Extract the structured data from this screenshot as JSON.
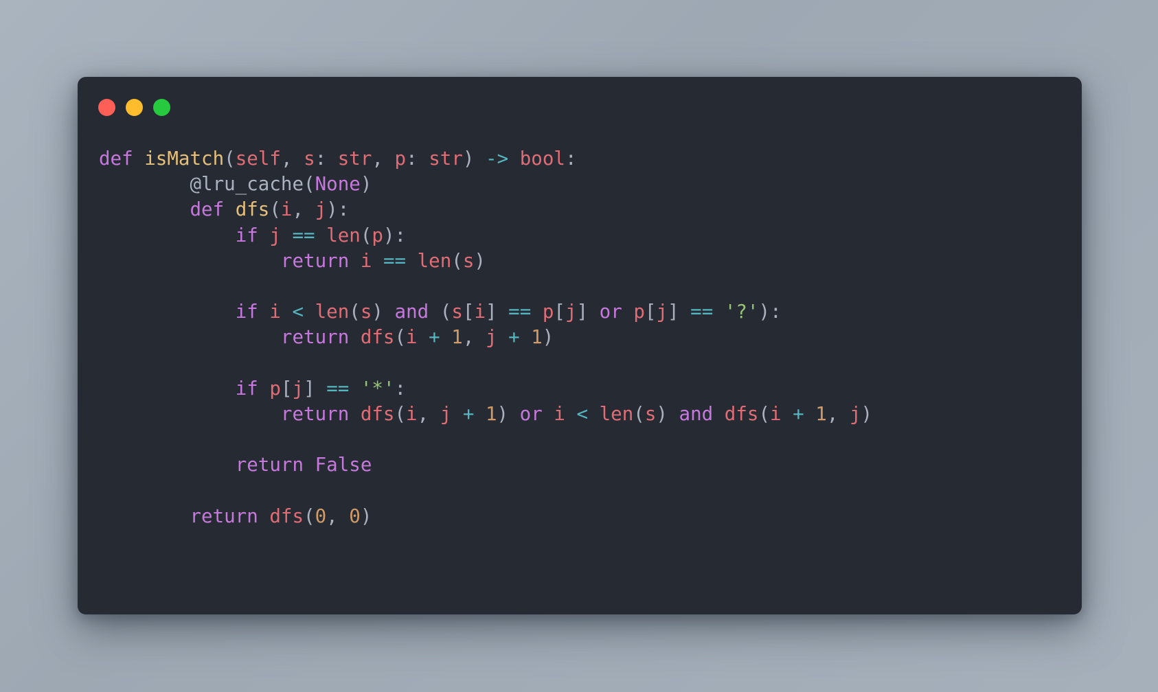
{
  "window": {
    "controls": [
      {
        "name": "close",
        "color": "#ff5f56"
      },
      {
        "name": "minimize",
        "color": "#ffbd2e"
      },
      {
        "name": "maximize",
        "color": "#27c93f"
      }
    ]
  },
  "code": {
    "language": "python",
    "lines": [
      [
        [
          "kw",
          "def"
        ],
        [
          "pu",
          " "
        ],
        [
          "fn",
          "isMatch"
        ],
        [
          "pu",
          "("
        ],
        [
          "var",
          "self"
        ],
        [
          "pu",
          ", "
        ],
        [
          "var",
          "s"
        ],
        [
          "pu",
          ": "
        ],
        [
          "ty",
          "str"
        ],
        [
          "pu",
          ", "
        ],
        [
          "var",
          "p"
        ],
        [
          "pu",
          ": "
        ],
        [
          "ty",
          "str"
        ],
        [
          "pu",
          ") "
        ],
        [
          "op",
          "->"
        ],
        [
          "pu",
          " "
        ],
        [
          "ty",
          "bool"
        ],
        [
          "pu",
          ":"
        ]
      ],
      [
        [
          "pu",
          "        "
        ],
        [
          "dec",
          "@lru_cache("
        ],
        [
          "const",
          "None"
        ],
        [
          "dec",
          ")"
        ]
      ],
      [
        [
          "pu",
          "        "
        ],
        [
          "kw",
          "def"
        ],
        [
          "pu",
          " "
        ],
        [
          "fn",
          "dfs"
        ],
        [
          "pu",
          "("
        ],
        [
          "var",
          "i"
        ],
        [
          "pu",
          ", "
        ],
        [
          "var",
          "j"
        ],
        [
          "pu",
          "):"
        ]
      ],
      [
        [
          "pu",
          "            "
        ],
        [
          "kw",
          "if"
        ],
        [
          "pu",
          " "
        ],
        [
          "var",
          "j"
        ],
        [
          "pu",
          " "
        ],
        [
          "op",
          "=="
        ],
        [
          "pu",
          " "
        ],
        [
          "fc",
          "len"
        ],
        [
          "pu",
          "("
        ],
        [
          "var",
          "p"
        ],
        [
          "pu",
          "):"
        ]
      ],
      [
        [
          "pu",
          "                "
        ],
        [
          "kw",
          "return"
        ],
        [
          "pu",
          " "
        ],
        [
          "var",
          "i"
        ],
        [
          "pu",
          " "
        ],
        [
          "op",
          "=="
        ],
        [
          "pu",
          " "
        ],
        [
          "fc",
          "len"
        ],
        [
          "pu",
          "("
        ],
        [
          "var",
          "s"
        ],
        [
          "pu",
          ")"
        ]
      ],
      [],
      [
        [
          "pu",
          "            "
        ],
        [
          "kw",
          "if"
        ],
        [
          "pu",
          " "
        ],
        [
          "var",
          "i"
        ],
        [
          "pu",
          " "
        ],
        [
          "op",
          "<"
        ],
        [
          "pu",
          " "
        ],
        [
          "fc",
          "len"
        ],
        [
          "pu",
          "("
        ],
        [
          "var",
          "s"
        ],
        [
          "pu",
          ") "
        ],
        [
          "kw",
          "and"
        ],
        [
          "pu",
          " ("
        ],
        [
          "var",
          "s"
        ],
        [
          "pu",
          "["
        ],
        [
          "var",
          "i"
        ],
        [
          "pu",
          "] "
        ],
        [
          "op",
          "=="
        ],
        [
          "pu",
          " "
        ],
        [
          "var",
          "p"
        ],
        [
          "pu",
          "["
        ],
        [
          "var",
          "j"
        ],
        [
          "pu",
          "] "
        ],
        [
          "kw",
          "or"
        ],
        [
          "pu",
          " "
        ],
        [
          "var",
          "p"
        ],
        [
          "pu",
          "["
        ],
        [
          "var",
          "j"
        ],
        [
          "pu",
          "] "
        ],
        [
          "op",
          "=="
        ],
        [
          "pu",
          " "
        ],
        [
          "str",
          "'?'"
        ],
        [
          "pu",
          "):"
        ]
      ],
      [
        [
          "pu",
          "                "
        ],
        [
          "kw",
          "return"
        ],
        [
          "pu",
          " "
        ],
        [
          "fc",
          "dfs"
        ],
        [
          "pu",
          "("
        ],
        [
          "var",
          "i"
        ],
        [
          "pu",
          " "
        ],
        [
          "op",
          "+"
        ],
        [
          "pu",
          " "
        ],
        [
          "num",
          "1"
        ],
        [
          "pu",
          ", "
        ],
        [
          "var",
          "j"
        ],
        [
          "pu",
          " "
        ],
        [
          "op",
          "+"
        ],
        [
          "pu",
          " "
        ],
        [
          "num",
          "1"
        ],
        [
          "pu",
          ")"
        ]
      ],
      [],
      [
        [
          "pu",
          "            "
        ],
        [
          "kw",
          "if"
        ],
        [
          "pu",
          " "
        ],
        [
          "var",
          "p"
        ],
        [
          "pu",
          "["
        ],
        [
          "var",
          "j"
        ],
        [
          "pu",
          "] "
        ],
        [
          "op",
          "=="
        ],
        [
          "pu",
          " "
        ],
        [
          "str",
          "'*'"
        ],
        [
          "pu",
          ":"
        ]
      ],
      [
        [
          "pu",
          "                "
        ],
        [
          "kw",
          "return"
        ],
        [
          "pu",
          " "
        ],
        [
          "fc",
          "dfs"
        ],
        [
          "pu",
          "("
        ],
        [
          "var",
          "i"
        ],
        [
          "pu",
          ", "
        ],
        [
          "var",
          "j"
        ],
        [
          "pu",
          " "
        ],
        [
          "op",
          "+"
        ],
        [
          "pu",
          " "
        ],
        [
          "num",
          "1"
        ],
        [
          "pu",
          ") "
        ],
        [
          "kw",
          "or"
        ],
        [
          "pu",
          " "
        ],
        [
          "var",
          "i"
        ],
        [
          "pu",
          " "
        ],
        [
          "op",
          "<"
        ],
        [
          "pu",
          " "
        ],
        [
          "fc",
          "len"
        ],
        [
          "pu",
          "("
        ],
        [
          "var",
          "s"
        ],
        [
          "pu",
          ") "
        ],
        [
          "kw",
          "and"
        ],
        [
          "pu",
          " "
        ],
        [
          "fc",
          "dfs"
        ],
        [
          "pu",
          "("
        ],
        [
          "var",
          "i"
        ],
        [
          "pu",
          " "
        ],
        [
          "op",
          "+"
        ],
        [
          "pu",
          " "
        ],
        [
          "num",
          "1"
        ],
        [
          "pu",
          ", "
        ],
        [
          "var",
          "j"
        ],
        [
          "pu",
          ")"
        ]
      ],
      [],
      [
        [
          "pu",
          "            "
        ],
        [
          "kw",
          "return"
        ],
        [
          "pu",
          " "
        ],
        [
          "kw",
          "False"
        ]
      ],
      [],
      [
        [
          "pu",
          "        "
        ],
        [
          "kw",
          "return"
        ],
        [
          "pu",
          " "
        ],
        [
          "fc",
          "dfs"
        ],
        [
          "pu",
          "("
        ],
        [
          "num",
          "0"
        ],
        [
          "pu",
          ", "
        ],
        [
          "num",
          "0"
        ],
        [
          "pu",
          ")"
        ]
      ]
    ]
  }
}
